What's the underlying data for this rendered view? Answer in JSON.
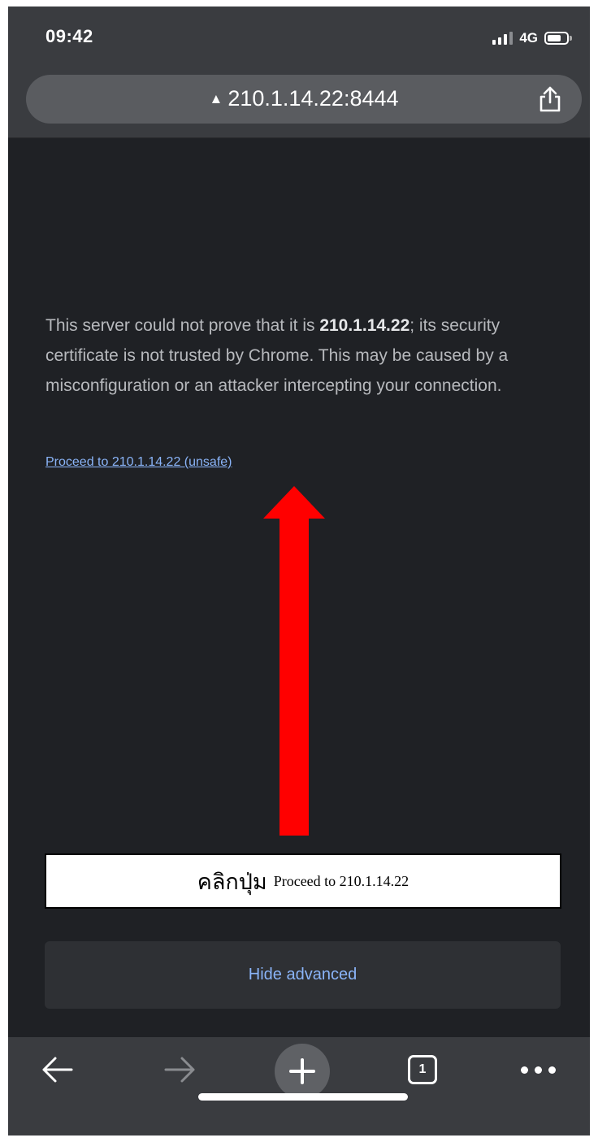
{
  "status_bar": {
    "time": "09:42",
    "network": "4G"
  },
  "address_bar": {
    "url": "210.1.14.22:8444",
    "warning_icon": "▲"
  },
  "interstitial": {
    "message_part1": "This server could not prove that it is ",
    "message_bold": "210.1.14.22",
    "message_part2": "; its security certificate is not trusted by Chrome. This may be caused by a misconfiguration or an attacker intercepting your connection.",
    "proceed_link": "Proceed to 210.1.14.22 (unsafe)",
    "hide_advanced": "Hide advanced"
  },
  "annotation": {
    "thai_text": "คลิกปุ่ม",
    "english_text": "Proceed to 210.1.14.22",
    "arrow_color": "#ff0000"
  },
  "toolbar": {
    "tab_count": "1"
  },
  "colors": {
    "page_bg": "#1f2125",
    "chrome_bg": "#3a3c40",
    "link": "#8ab4f8",
    "text": "#b7b9bd"
  }
}
